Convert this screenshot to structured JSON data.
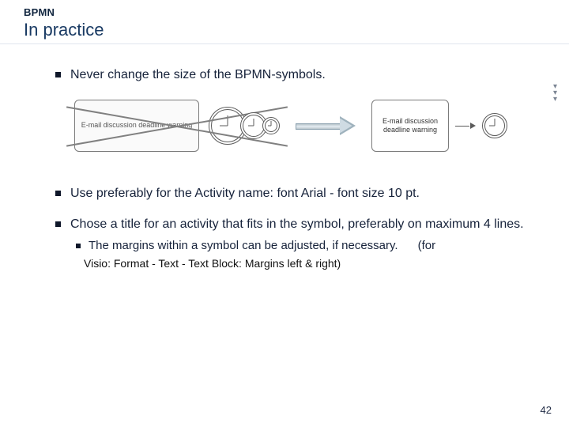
{
  "header": {
    "kicker": "BPMN",
    "title": "In practice"
  },
  "bullets": {
    "b1": "Never change the size of the BPMN-symbols.",
    "b2": "Use preferably for the Activity name: font Arial - font size 10 pt.",
    "b3": "Chose a title for an activity that fits in the symbol, preferably on maximum 4 lines.",
    "sub1": "The margins within a symbol can be adjusted, if necessary.",
    "sub1_note": "(for",
    "sub1_cont": "Visio: Format - Text - Text Block: Margins left & right)"
  },
  "diagram": {
    "wrong_task_label": "E-mail discussion deadline warning",
    "right_task_label": "E-mail discussion deadline warning"
  },
  "page_number": "42"
}
